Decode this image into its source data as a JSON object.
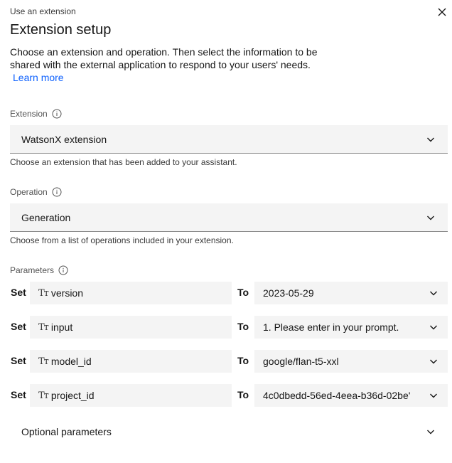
{
  "header": {
    "overline": "Use an extension",
    "title": "Extension setup",
    "description": "Choose an extension and operation. Then select the information to be shared with the external application to respond to your users' needs.",
    "learn_more": "Learn more"
  },
  "extension": {
    "label": "Extension",
    "value": "WatsonX extension",
    "helper": "Choose an extension that has been added to your assistant."
  },
  "operation": {
    "label": "Operation",
    "value": "Generation",
    "helper": "Choose from a list of operations included in your extension."
  },
  "parameters": {
    "label": "Parameters",
    "set_label": "Set",
    "to_label": "To",
    "type_icon": "Tт",
    "rows": [
      {
        "name": "version",
        "value": "2023-05-29"
      },
      {
        "name": "input",
        "value": "1. Please enter in your prompt."
      },
      {
        "name": "model_id",
        "value": "google/flan-t5-xxl"
      },
      {
        "name": "project_id",
        "value": "4c0dbedd-56ed-4eea-b36d-02be'"
      }
    ]
  },
  "optional": {
    "label": "Optional parameters"
  },
  "colors": {
    "link": "#0f62fe",
    "field_bg": "#f4f4f4"
  }
}
